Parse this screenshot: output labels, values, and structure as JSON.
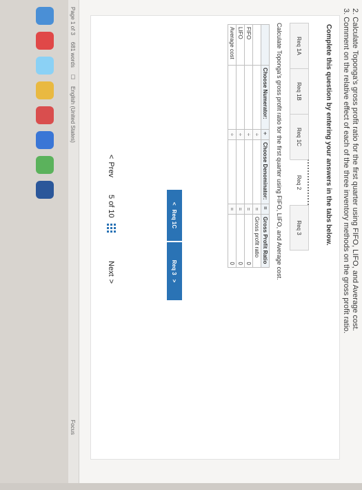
{
  "instructions": {
    "line2": "2. Calculate Toponga's gross profit ratio for the first quarter using FIFO, LIFO, and Average cost.",
    "line3": "3. Comment on the relative effect of each of the three inventory methods on the gross profit ratio."
  },
  "panel": {
    "heading": "Complete this question by entering your answers in the tabs below.",
    "tabs": [
      {
        "label": "Req 1A"
      },
      {
        "label": "Req 1B"
      },
      {
        "label": "Req 1C"
      },
      {
        "label": "Req 2"
      },
      {
        "label": "Req 3"
      }
    ],
    "active_tab": "Req 2",
    "question": "Calculate Toponga's gross profit ratio for the first quarter using FIFO, LIFO, and Average cost."
  },
  "table": {
    "headers": {
      "numerator": "Choose Numerator:",
      "divide": "÷",
      "denominator": "Choose Denominator:",
      "equals": "=",
      "result": "Gross Profit Ratio"
    },
    "result_subheader": "Gross profit ratio",
    "rows": [
      {
        "label": "FIFO",
        "divide": "÷",
        "equals": "=",
        "result": "0"
      },
      {
        "label": "LIFO",
        "divide": "÷",
        "equals": "=",
        "result": "0"
      },
      {
        "label": "Average cost",
        "divide": "÷",
        "equals": "=",
        "result": "0"
      }
    ]
  },
  "nav_buttons": {
    "prev": {
      "arrow": "<",
      "label": "Req 1C"
    },
    "next": {
      "label": "Req 3",
      "arrow": ">"
    }
  },
  "pager": {
    "prev_arrow": "<",
    "prev_label": "Prev",
    "current": "5",
    "of_text": "of 10",
    "next_label": "Next",
    "next_arrow": ">"
  },
  "statusbar": {
    "page": "Page 1 of 3",
    "words": "681 words",
    "language": "English (United States)",
    "focus": "Focus"
  },
  "colors": {
    "accent": "#2a73b5",
    "header_bg": "#eef3f7"
  }
}
